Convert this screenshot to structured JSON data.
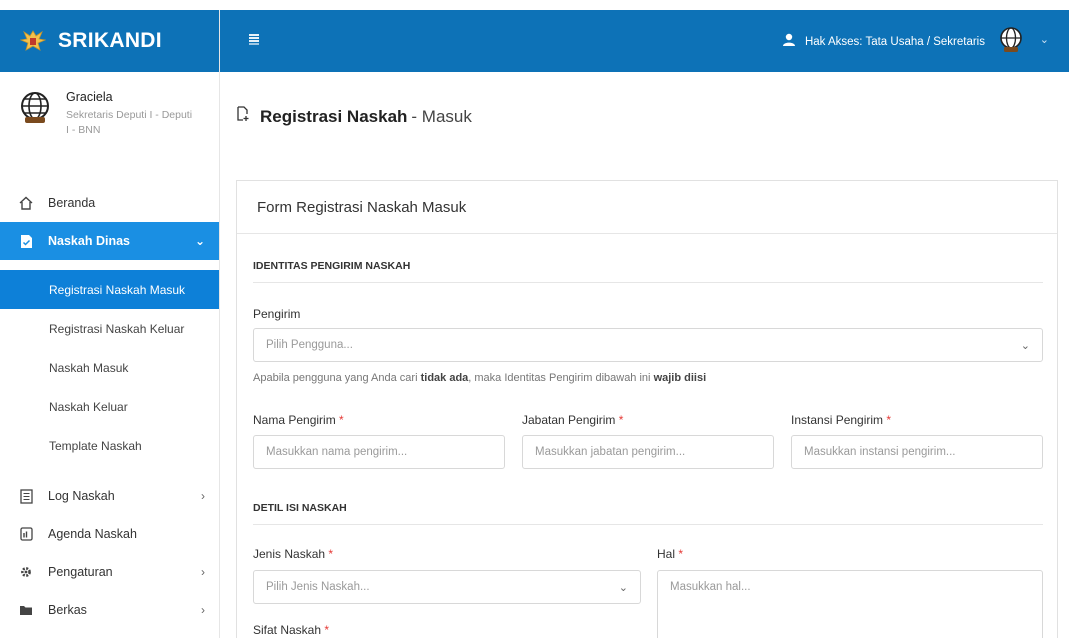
{
  "brand": {
    "name": "SRIKANDI"
  },
  "user": {
    "name": "Graciela",
    "role": "Sekretaris Deputi I - Deputi I - BNN"
  },
  "sidebar": {
    "items": [
      {
        "label": "Beranda"
      },
      {
        "label": "Naskah Dinas"
      },
      {
        "label": "Log Naskah"
      },
      {
        "label": "Agenda Naskah"
      },
      {
        "label": "Pengaturan"
      },
      {
        "label": "Berkas"
      }
    ],
    "submenu": [
      {
        "label": "Registrasi Naskah Masuk"
      },
      {
        "label": "Registrasi Naskah Keluar"
      },
      {
        "label": "Naskah Masuk"
      },
      {
        "label": "Naskah Keluar"
      },
      {
        "label": "Template Naskah"
      }
    ]
  },
  "topbar": {
    "access": "Hak Akses: Tata Usaha / Sekretaris"
  },
  "page": {
    "title": "Registrasi Naskah",
    "subtitle": "- Masuk"
  },
  "form": {
    "card_title": "Form Registrasi Naskah Masuk",
    "section1": "IDENTITAS PENGIRIM NASKAH",
    "pengirim_label": "Pengirim",
    "pengirim_placeholder": "Pilih Pengguna...",
    "hint_1": "Apabila pengguna yang Anda cari",
    "hint_bold_1": "tidak ada",
    "hint_2": ", maka Identitas Pengirim dibawah ini",
    "hint_bold_2": "wajib diisi",
    "nama_label": "Nama Pengirim",
    "nama_placeholder": "Masukkan nama pengirim...",
    "jabatan_label": "Jabatan Pengirim",
    "jabatan_placeholder": "Masukkan jabatan pengirim...",
    "instansi_label": "Instansi Pengirim",
    "instansi_placeholder": "Masukkan instansi pengirim...",
    "section2": "DETIL ISI NASKAH",
    "jenis_label": "Jenis Naskah",
    "jenis_placeholder": "Pilih Jenis Naskah...",
    "hal_label": "Hal",
    "hal_placeholder": "Masukkan hal...",
    "sifat_label": "Sifat Naskah",
    "required_mark": "*"
  },
  "colors": {
    "primary": "#0d72b7",
    "active": "#1a8fe3",
    "required": "#e53935"
  }
}
